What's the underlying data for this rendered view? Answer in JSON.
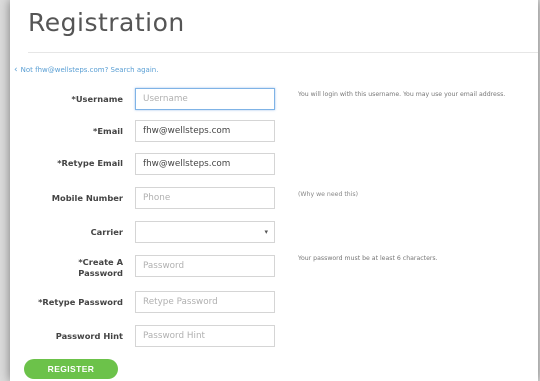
{
  "title": "Registration",
  "back_link": "Not fhw@wellsteps.com? Search again.",
  "fields": {
    "username": {
      "label": "*Username",
      "value": "",
      "placeholder": "Username"
    },
    "email": {
      "label": "*Email",
      "value": "fhw@wellsteps.com"
    },
    "retype_email": {
      "label": "*Retype Email",
      "value": "fhw@wellsteps.com"
    },
    "mobile": {
      "label": "Mobile Number",
      "value": "",
      "placeholder": "Phone"
    },
    "carrier": {
      "label": "Carrier",
      "value": ""
    },
    "password": {
      "label1": "*Create A",
      "label2": "Password",
      "value": "",
      "placeholder": "Password"
    },
    "retype_password": {
      "label": "*Retype Password",
      "value": "",
      "placeholder": "Retype Password"
    },
    "password_hint": {
      "label": "Password Hint",
      "value": "",
      "placeholder": "Password Hint"
    }
  },
  "hints": {
    "username": "You will login with this username. You may use your email address.",
    "mobile": "(Why we need this)",
    "password": "Your password must be at least 6 characters."
  },
  "register_label": "REGISTER",
  "icons": {
    "back": "chevron-left-icon",
    "select": "caret-down-icon"
  },
  "colors": {
    "accent_green": "#6cc24a",
    "link_blue": "#5a9fd4",
    "focus_blue": "#7fb3e6"
  }
}
